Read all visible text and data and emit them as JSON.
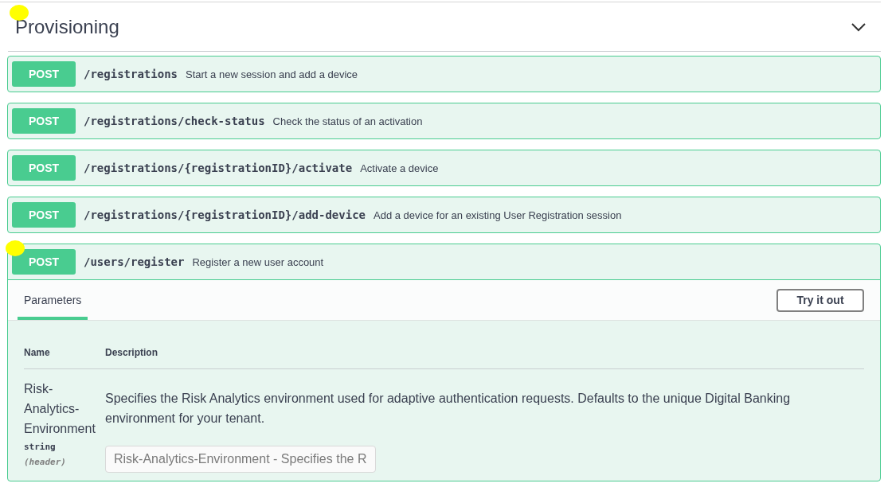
{
  "section": {
    "title": "Provisioning",
    "expanded": true,
    "marked": true
  },
  "operations": [
    {
      "method": "POST",
      "path": "/registrations",
      "summary": "Start a new session and add a device",
      "expanded": false,
      "marked": false
    },
    {
      "method": "POST",
      "path": "/registrations/check-status",
      "summary": "Check the status of an activation",
      "expanded": false,
      "marked": false
    },
    {
      "method": "POST",
      "path": "/registrations/{registrationID}/activate",
      "summary": "Activate a device",
      "expanded": false,
      "marked": false
    },
    {
      "method": "POST",
      "path": "/registrations/{registrationID}/add-device",
      "summary": "Add a device for an existing User Registration session",
      "expanded": false,
      "marked": false
    },
    {
      "method": "POST",
      "path": "/users/register",
      "summary": "Register a new user account",
      "expanded": true,
      "marked": true,
      "tabs": [
        {
          "label": "Parameters",
          "selected": true
        }
      ],
      "try_button": "Try it out",
      "columns": [
        "Name",
        "Description"
      ],
      "parameters": [
        {
          "name": "Risk-Analytics-Environment",
          "type": "string",
          "location": "(header)",
          "description": "Specifies the Risk Analytics environment used for adaptive authentication requests. Defaults to the unique Digital Banking environment for your tenant.",
          "placeholder": "Risk-Analytics-Environment - Specifies the R"
        }
      ]
    }
  ]
}
